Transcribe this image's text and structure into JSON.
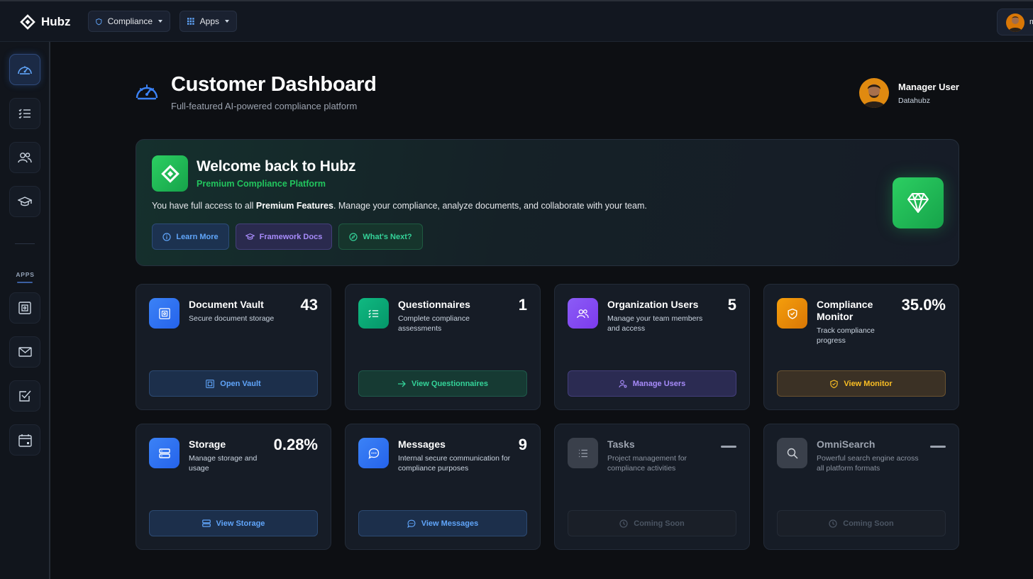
{
  "topbar": {
    "brand": "Hubz",
    "menus": [
      {
        "label": "Compliance",
        "icon": "shield-icon"
      },
      {
        "label": "Apps",
        "icon": "grid-icon"
      }
    ],
    "profile_initial": "m"
  },
  "sidebar": {
    "items": [
      {
        "name": "dashboard",
        "icon": "speedometer-icon",
        "active": true
      },
      {
        "name": "checklist",
        "icon": "list-check-icon"
      },
      {
        "name": "users",
        "icon": "users-icon"
      },
      {
        "name": "training",
        "icon": "graduation-cap-icon"
      }
    ],
    "apps_label": "APPS",
    "apps": [
      {
        "name": "vault",
        "icon": "safe-icon"
      },
      {
        "name": "messages",
        "icon": "envelope-icon"
      },
      {
        "name": "tasks",
        "icon": "checkbox-icon"
      },
      {
        "name": "calendar",
        "icon": "calendar-icon"
      }
    ]
  },
  "header": {
    "title": "Customer Dashboard",
    "subtitle": "Full-featured AI-powered compliance platform",
    "user_name": "Manager User",
    "user_org": "Datahubz"
  },
  "welcome": {
    "title": "Welcome back to Hubz",
    "subtitle": "Premium Compliance Platform",
    "text_before": "You have full access to all ",
    "text_bold": "Premium Features",
    "text_after": ". Manage your compliance, analyze documents, and collaborate with your team.",
    "buttons": {
      "learn": "Learn More",
      "docs": "Framework Docs",
      "next": "What's Next?"
    },
    "accent": "#22c55e"
  },
  "cards": [
    {
      "title": "Document Vault",
      "desc": "Secure document storage",
      "value": "43",
      "button": "Open Vault",
      "color": "#3b82f6"
    },
    {
      "title": "Questionnaires",
      "desc": "Complete compliance assessments",
      "value": "1",
      "button": "View Questionnaires",
      "color": "#10b981"
    },
    {
      "title": "Organization Users",
      "desc": "Manage your team members and access",
      "value": "5",
      "button": "Manage Users",
      "color": "#8b5cf6"
    },
    {
      "title": "Compliance Monitor",
      "desc": "Track compliance progress",
      "value": "35.0%",
      "button": "View Monitor",
      "color": "#f59e0b"
    },
    {
      "title": "Storage",
      "desc": "Manage storage and usage",
      "value": "0.28%",
      "button": "View Storage",
      "color": "#3b82f6"
    },
    {
      "title": "Messages",
      "desc": "Internal secure communication for compliance purposes",
      "value": "9",
      "button": "View Messages",
      "color": "#3b82f6"
    },
    {
      "title": "Tasks",
      "desc": "Project management for compliance activities",
      "value": "",
      "button": "Coming Soon",
      "color": "#6b7280"
    },
    {
      "title": "OmniSearch",
      "desc": "Powerful search engine across all platform formats",
      "value": "",
      "button": "Coming Soon",
      "color": "#6b7280"
    }
  ]
}
